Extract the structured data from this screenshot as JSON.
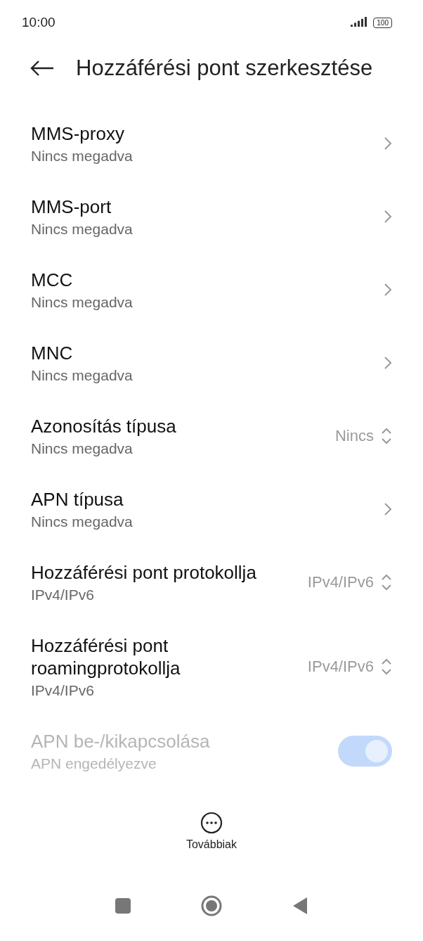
{
  "status_bar": {
    "time": "10:00",
    "battery": "100"
  },
  "header": {
    "title": "Hozzáférési pont szerkesztése"
  },
  "settings": [
    {
      "kind": "link",
      "title": "MMS-proxy",
      "subtitle": "Nincs megadva"
    },
    {
      "kind": "link",
      "title": "MMS-port",
      "subtitle": "Nincs megadva"
    },
    {
      "kind": "link",
      "title": "MCC",
      "subtitle": "Nincs megadva"
    },
    {
      "kind": "link",
      "title": "MNC",
      "subtitle": "Nincs megadva"
    },
    {
      "kind": "select",
      "title": "Azonosítás típusa",
      "subtitle": "Nincs megadva",
      "value": "Nincs"
    },
    {
      "kind": "link",
      "title": "APN típusa",
      "subtitle": "Nincs megadva"
    },
    {
      "kind": "select",
      "title": "Hozzáférési pont protokollja",
      "subtitle": "IPv4/IPv6",
      "value": "IPv4/IPv6"
    },
    {
      "kind": "select",
      "title": "Hozzáférési pont roamingprotokollja",
      "subtitle": "IPv4/IPv6",
      "value": "IPv4/IPv6"
    },
    {
      "kind": "toggle",
      "title": "APN be-/kikapcsolása",
      "subtitle": "APN engedélyezve",
      "on": true,
      "disabled": true
    }
  ],
  "more_button": {
    "label": "Továbbiak"
  }
}
